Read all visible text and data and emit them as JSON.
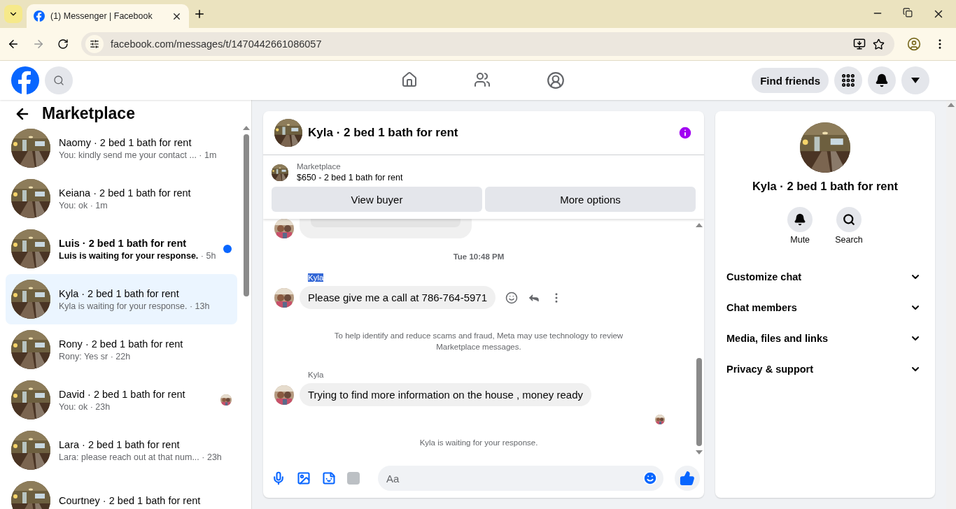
{
  "browser": {
    "tab_title": "(1) Messenger | Facebook",
    "url": "facebook.com/messages/t/1470442661086057"
  },
  "header": {
    "find_friends": "Find friends"
  },
  "sidebar": {
    "title": "Marketplace",
    "conversations": [
      {
        "name": "Naomy · 2 bed 1 bath for rent",
        "preview": "You: kindly send me your contact ...",
        "time": " · 1m",
        "unread": false,
        "selected": false,
        "seen": false
      },
      {
        "name": "Keiana · 2 bed 1 bath for rent",
        "preview": "You: ok",
        "time": " · 1m",
        "unread": false,
        "selected": false,
        "seen": false
      },
      {
        "name": "Luis · 2 bed 1 bath for rent",
        "preview": "Luis is waiting for your response.",
        "time": " · 5h",
        "unread": true,
        "selected": false,
        "seen": false
      },
      {
        "name": "Kyla · 2 bed 1 bath for rent",
        "preview": "Kyla is waiting for your response.",
        "time": " · 13h",
        "unread": false,
        "selected": true,
        "seen": false
      },
      {
        "name": "Rony · 2 bed 1 bath for rent",
        "preview": "Rony: Yes sr",
        "time": " · 22h",
        "unread": false,
        "selected": false,
        "seen": false
      },
      {
        "name": "David · 2 bed 1 bath for rent",
        "preview": "You: ok",
        "time": " · 23h",
        "unread": false,
        "selected": false,
        "seen": true
      },
      {
        "name": "Lara · 2 bed 1 bath for rent",
        "preview": "Lara: please reach out at that num...",
        "time": " · 23h",
        "unread": false,
        "selected": false,
        "seen": false
      },
      {
        "name": "Courtney · 2 bed 1 bath for rent",
        "unread": false,
        "selected": false,
        "seen": false
      }
    ]
  },
  "chat": {
    "title": "Kyla · 2 bed 1 bath for rent",
    "listing": {
      "label": "Marketplace",
      "text": "$650 - 2 bed 1 bath for rent"
    },
    "actions": [
      "View buyer",
      "More options"
    ],
    "messages": [
      {
        "kind": "partial"
      },
      {
        "kind": "timestamp",
        "text": "Tue 10:48 PM"
      },
      {
        "kind": "incoming",
        "sender": "Kyla",
        "highlighted": true,
        "text": "Please give me a call at 786-764-5971",
        "hover_actions": true
      },
      {
        "kind": "notice",
        "text": "To help identify and reduce scams and fraud, Meta may use technology to review Marketplace messages."
      },
      {
        "kind": "incoming",
        "sender": "Kyla",
        "highlighted": false,
        "text": "Trying to find more information on the house , money ready",
        "hover_actions": false
      },
      {
        "kind": "seen"
      },
      {
        "kind": "notice",
        "text": "Kyla is waiting for your response."
      }
    ],
    "composer": {
      "placeholder": "Aa"
    }
  },
  "details": {
    "title": "Kyla · 2 bed 1 bath for rent",
    "actions": [
      {
        "kind": "mute",
        "label": "Mute"
      },
      {
        "kind": "search",
        "label": "Search"
      }
    ],
    "sections": [
      {
        "label": "Customize chat",
        "expanded": false
      },
      {
        "label": "Chat members",
        "expanded": false
      },
      {
        "label": "Media, files and links",
        "expanded": false
      },
      {
        "label": "Privacy & support",
        "expanded": false
      }
    ]
  }
}
